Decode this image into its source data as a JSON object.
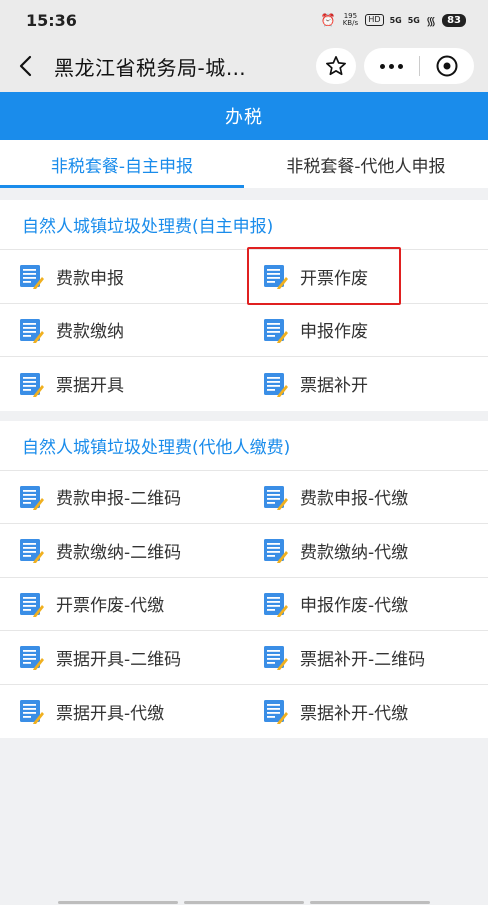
{
  "status": {
    "time": "15:36",
    "speed": "195\nKB/s",
    "hd": "HD",
    "signal1": "5G",
    "signal2": "5G",
    "battery": "83"
  },
  "titlebar": {
    "title": "黑龙江省税务局-城…"
  },
  "header": {
    "title": "办税"
  },
  "tabs": [
    {
      "label": "非税套餐-自主申报",
      "active": true
    },
    {
      "label": "非税套餐-代他人申报",
      "active": false
    }
  ],
  "sections": [
    {
      "title": "自然人城镇垃圾处理费(自主申报)",
      "items": [
        "费款申报",
        "开票作废",
        "费款缴纳",
        "申报作废",
        "票据开具",
        "票据补开"
      ]
    },
    {
      "title": "自然人城镇垃圾处理费(代他人缴费)",
      "items": [
        "费款申报-二维码",
        "费款申报-代缴",
        "费款缴纳-二维码",
        "费款缴纳-代缴",
        "开票作废-代缴",
        "申报作废-代缴",
        "票据开具-二维码",
        "票据补开-二维码",
        "票据开具-代缴",
        "票据补开-代缴"
      ]
    }
  ],
  "colors": {
    "accent": "#1a8ceb",
    "highlight": "#e02020"
  },
  "icons": {
    "item": "document-edit-icon"
  }
}
